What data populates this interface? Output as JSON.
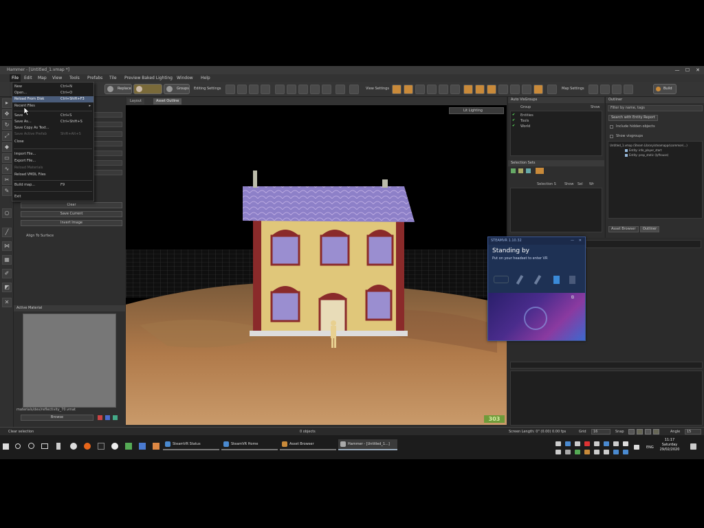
{
  "window": {
    "title": "Hammer - [Untitled_1.vmap *]",
    "controls": [
      "—",
      "☐",
      "✕"
    ]
  },
  "menubar": [
    "File",
    "Edit",
    "Map",
    "View",
    "Tools",
    "Prefabs",
    "Tile",
    "Preview Baked Lighting",
    "Window",
    "Help"
  ],
  "toolbar": {
    "selection_modes": [
      "Replace",
      "",
      "Groups"
    ],
    "editing_settings_label": "Editing Settings",
    "view_settings_label": "View Settings",
    "map_settings_label": "Map Settings",
    "build_label": "Build"
  },
  "file_menu": {
    "items": [
      {
        "label": "New",
        "shortcut": "Ctrl+N"
      },
      {
        "label": "Open...",
        "shortcut": "Ctrl+O"
      },
      {
        "label": "Reload From Disk",
        "shortcut": "Ctrl+Shift+F3",
        "highlighted": true
      },
      {
        "label": "Recent Files",
        "shortcut": "",
        "submenu": true
      },
      {
        "label": "Save",
        "shortcut": "Ctrl+S"
      },
      {
        "label": "Save As...",
        "shortcut": "Ctrl+Shift+S"
      },
      {
        "label": "Save Copy As Text...",
        "shortcut": ""
      },
      {
        "label": "Save Active Prefab",
        "shortcut": "Shift+Alt+S",
        "disabled": true
      },
      {
        "label": "Close",
        "shortcut": ""
      },
      {
        "label": "Import File...",
        "shortcut": ""
      },
      {
        "label": "Export File...",
        "shortcut": ""
      },
      {
        "label": "Reload Materials",
        "shortcut": "",
        "disabled": true
      },
      {
        "label": "Reload VMDL Files",
        "shortcut": ""
      },
      {
        "label": "Build map...",
        "shortcut": "F9"
      },
      {
        "label": "Exit",
        "shortcut": ""
      }
    ]
  },
  "left_panel": {
    "buttons": [
      "Clear",
      "Save Current",
      "Invert Image"
    ],
    "checkbox_label": "Align To Surface",
    "material_header": "Active Material",
    "material_path": "materials/dev/reflectivity_70.vmat",
    "browse_label": "Browse"
  },
  "viewport": {
    "tabs": [
      "Layout",
      "Asset Outline"
    ],
    "render_mode": "Lit Lighting",
    "fps": "303"
  },
  "auto_visgroups": {
    "header": "Auto VisGroups",
    "columns": [
      "Group",
      "Show"
    ],
    "rows": [
      {
        "label": "Entities",
        "checked": true
      },
      {
        "label": "Tools",
        "checked": true
      },
      {
        "label": "World",
        "checked": true
      }
    ]
  },
  "selection_sets": {
    "header": "Selection Sets",
    "columns": [
      "Selection S",
      "Show",
      "Sel",
      "Wr"
    ]
  },
  "outliner": {
    "header": "Outliner",
    "filter_placeholder": "Filter by name, tags",
    "search_label": "Search with Entity Report",
    "include_hidden": "Include hidden objects",
    "show_visgroups": "Show visgroups",
    "tree": [
      "Untitled_1.vmap (Steam Library\\steamapps\\common\\...)",
      "Entity: info_player_start",
      "Entity: prop_static (lyfhouse)"
    ],
    "tabs": [
      "Asset Browser",
      "Outliner"
    ]
  },
  "steamvr": {
    "title": "STEAMVR 1.10.32",
    "status": "Standing by",
    "message": "Put on your headset to enter VR"
  },
  "statusbar": {
    "left": "Clear selection",
    "objects": "0 objects",
    "screen_length": "Screen Length: 0\" (0.00) 0.00 fps",
    "grid_label": "Grid",
    "grid_value": "16",
    "snap_label": "Snap",
    "angle_label": "Angle",
    "angle_value": "15"
  },
  "taskbar": {
    "apps": [
      {
        "label": "SteamVR Status",
        "active": false
      },
      {
        "label": "SteamVR Home",
        "active": false
      },
      {
        "label": "Asset Browser",
        "active": false
      },
      {
        "label": "Hammer - [Untitled_1...]",
        "active": true
      }
    ],
    "lang": "ENG",
    "time": "11:17",
    "day": "Saturday",
    "date": "29/02/2020"
  },
  "colors": {
    "accent_highlight": "#4a5c7a",
    "steamvr_panel": "#1b2a4a",
    "fps_badge": "#6f9b3a"
  }
}
